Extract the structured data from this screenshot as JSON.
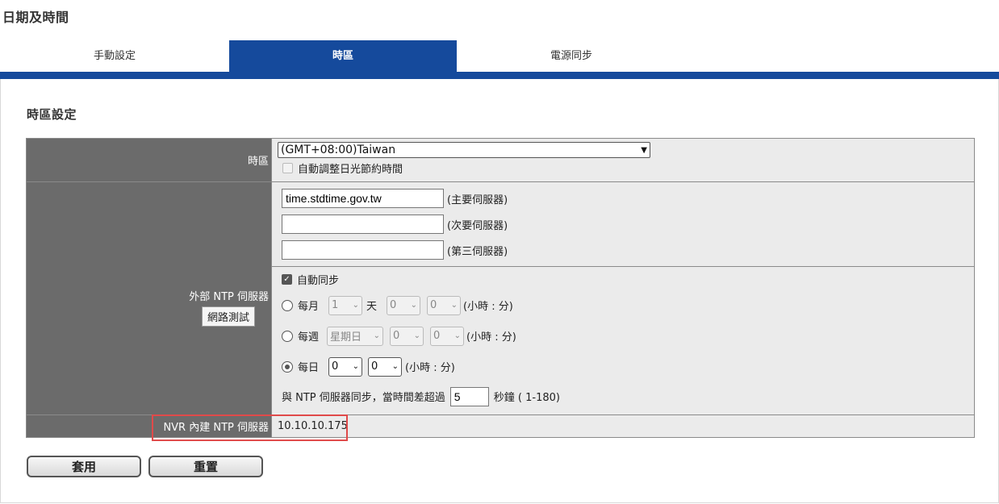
{
  "page": {
    "title": "日期及時間"
  },
  "tabs": [
    {
      "label": "手動設定",
      "active": false
    },
    {
      "label": "時區",
      "active": true
    },
    {
      "label": "電源同步",
      "active": false
    }
  ],
  "section": {
    "title": "時區設定"
  },
  "timezone": {
    "label": "時區",
    "selected": "(GMT+08:00)Taiwan",
    "dst_label": "自動調整日光節約時間",
    "dst_checked": false
  },
  "ntp": {
    "label": "外部 NTP 伺服器",
    "test_button": "網路測試",
    "servers": [
      {
        "value": "time.stdtime.gov.tw",
        "label": "(主要伺服器)"
      },
      {
        "value": "",
        "label": "(次要伺服器)"
      },
      {
        "value": "",
        "label": "(第三伺服器)"
      }
    ],
    "auto_sync_label": "自動同步",
    "auto_sync_checked": true,
    "monthly": {
      "label": "每月",
      "day": "1",
      "day_unit": "天",
      "hour": "0",
      "minute": "0",
      "unit": "(小時 : 分)"
    },
    "weekly": {
      "label": "每週",
      "weekday": "星期日",
      "hour": "0",
      "minute": "0",
      "unit": "(小時 : 分)"
    },
    "daily": {
      "label": "每日",
      "hour": "0",
      "minute": "0",
      "unit": "(小時 : 分)",
      "selected": true
    },
    "threshold_prefix": "與 NTP 伺服器同步，當時間差超過",
    "threshold_value": "5",
    "threshold_suffix": "秒鐘 ( 1-180)"
  },
  "internal_ntp": {
    "label": "NVR 內建 NTP 伺服器",
    "value": "10.10.10.175"
  },
  "buttons": {
    "apply": "套用",
    "reset": "重置"
  },
  "colors": {
    "accent": "#154a9c",
    "label_bg": "#6b6b6b",
    "highlight": "#e04a4a"
  }
}
